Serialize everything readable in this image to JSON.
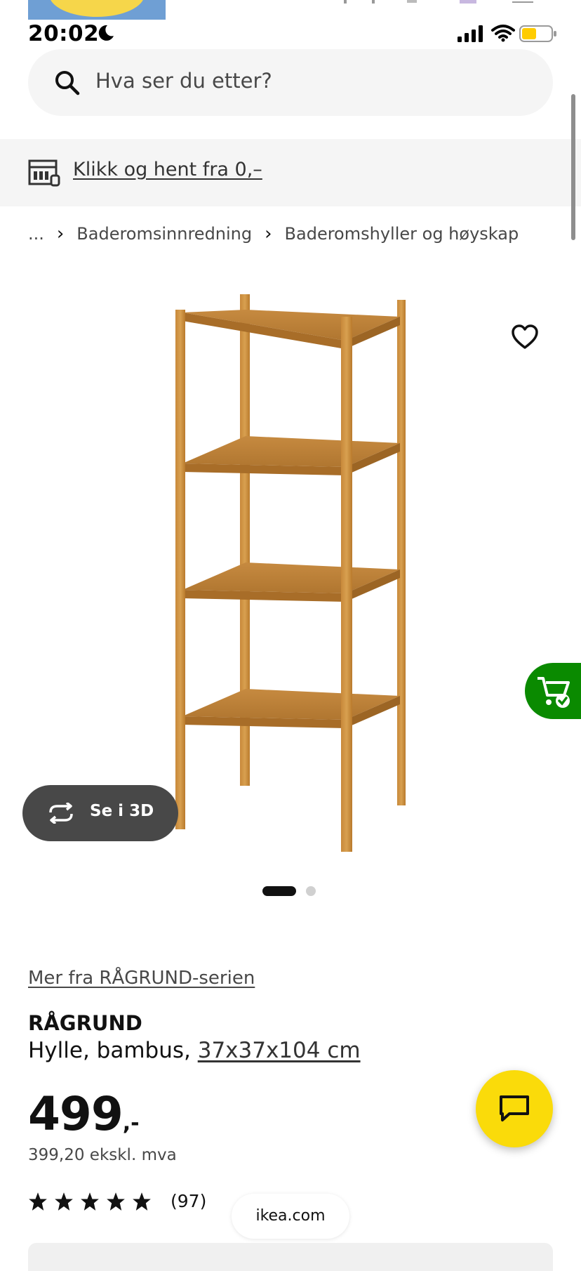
{
  "status_bar": {
    "time": "20:02",
    "battery_level": 0.5,
    "battery_color": "#ffcc00"
  },
  "search": {
    "placeholder": "Hva ser du etter?",
    "icon": "search-icon"
  },
  "banner": {
    "icon": "store-icon",
    "link_text": "Klikk og hent fra 0,–"
  },
  "breadcrumb": {
    "items": [
      "...",
      "Baderomsinnredning",
      "Baderomshyller og høyskap"
    ]
  },
  "gallery": {
    "see_3d_label": "Se i 3D",
    "page_count": 2,
    "current_page": 1
  },
  "product": {
    "series_link": "Mer fra RÅGRUND-serien",
    "name": "RÅGRUND",
    "description": "Hylle, bambus, ",
    "dimensions": "37x37x104 cm",
    "price_integer": "499",
    "price_suffix": ",-",
    "price_excl_vat": "399,20 ekskl. mva",
    "rating_stars": 5,
    "rating_count": "(97)"
  },
  "browser": {
    "url": "ikea.com"
  },
  "colors": {
    "brand_yellow": "#fadb0a",
    "cart_green": "#0a8a00",
    "see3d_bg": "#484848"
  }
}
